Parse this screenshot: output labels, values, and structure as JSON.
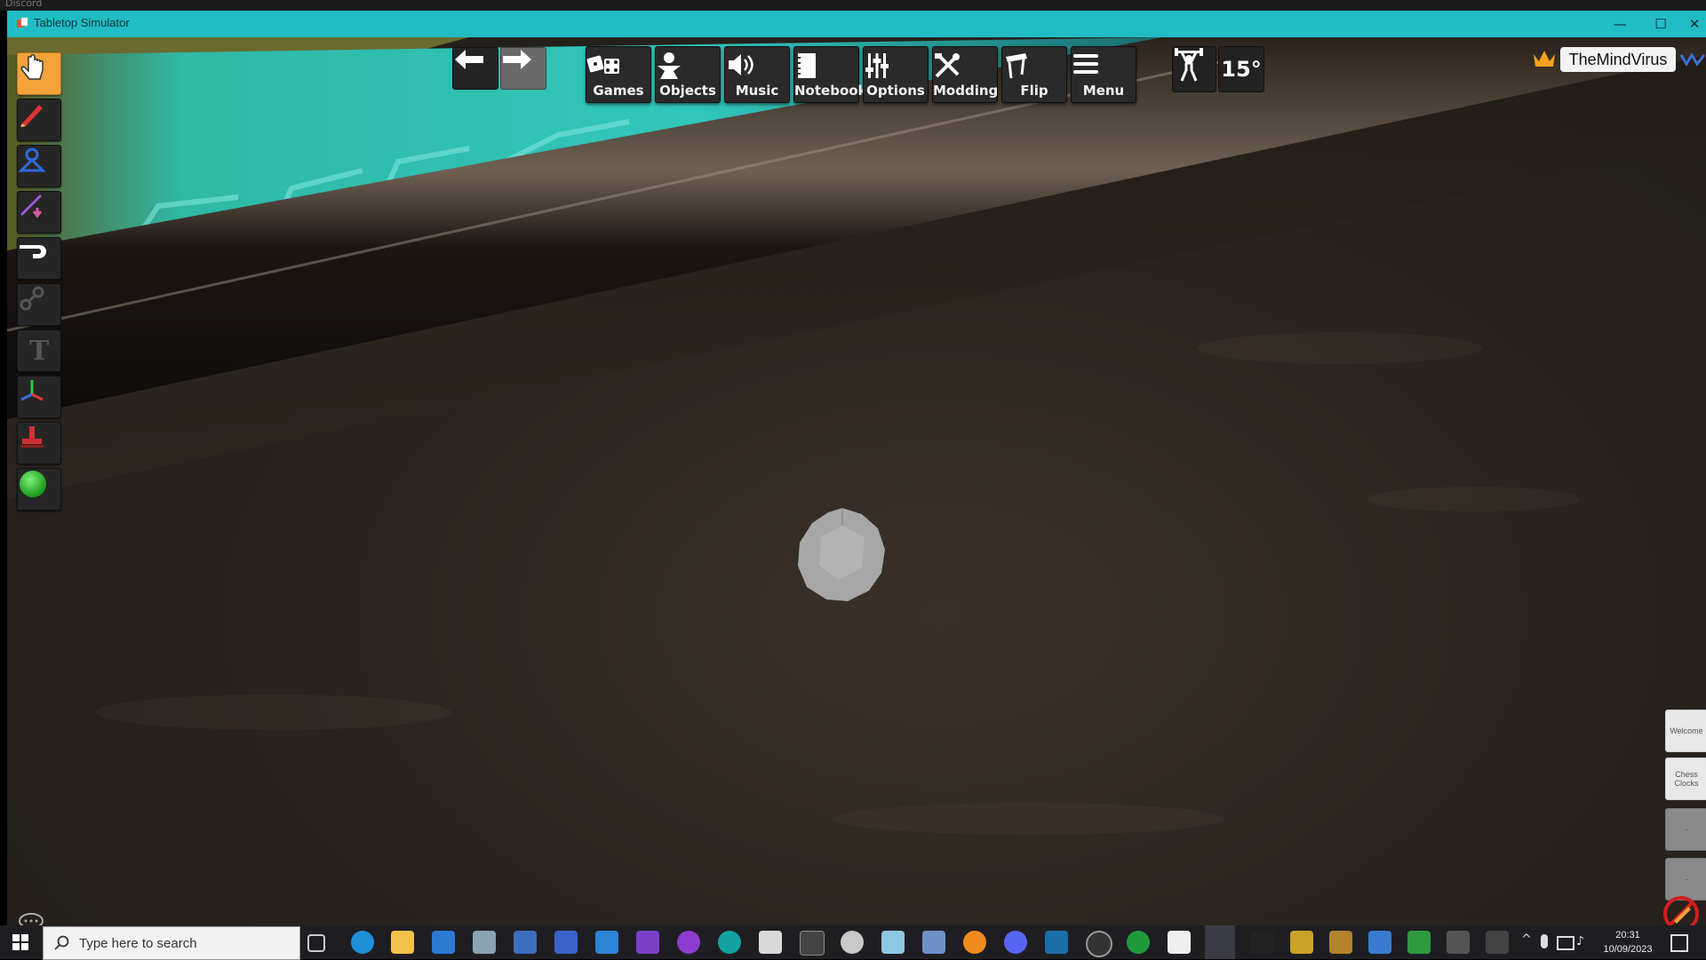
{
  "background_window": {
    "title": "Discord"
  },
  "window": {
    "title": "Tabletop Simulator",
    "controls": {
      "minimize": "—",
      "maximize": "☐",
      "close": "✕"
    }
  },
  "left_tools": [
    {
      "name": "grab",
      "icon": "hand-pointer-icon",
      "active": true
    },
    {
      "name": "draw",
      "icon": "pen-icon"
    },
    {
      "name": "zones",
      "icon": "zone-icon"
    },
    {
      "name": "line",
      "icon": "line-tool-icon"
    },
    {
      "name": "flick",
      "icon": "flick-icon"
    },
    {
      "name": "joint",
      "icon": "joint-icon"
    },
    {
      "name": "text",
      "icon": "text-tool-icon",
      "label": "T"
    },
    {
      "name": "gizmo",
      "icon": "gizmo-icon"
    },
    {
      "name": "snap",
      "icon": "snap-point-icon"
    },
    {
      "name": "decal",
      "icon": "color-ball-icon"
    }
  ],
  "top_menu": {
    "undo": "undo-arrow-icon",
    "redo": "redo-arrow-icon",
    "buttons": [
      {
        "label": "Games",
        "icon": "games-dice-icon"
      },
      {
        "label": "Objects",
        "icon": "objects-pawn-icon"
      },
      {
        "label": "Music",
        "icon": "music-speaker-icon"
      },
      {
        "label": "Notebook",
        "icon": "notebook-icon"
      },
      {
        "label": "Options",
        "icon": "options-sliders-icon"
      },
      {
        "label": "Modding",
        "icon": "modding-tools-icon"
      },
      {
        "label": "Flip",
        "icon": "flip-table-icon"
      },
      {
        "label": "Menu",
        "icon": "menu-hamburger-icon"
      }
    ],
    "rotation_snap": "15°"
  },
  "player": {
    "name": "TheMindVirus",
    "crown_color": "#f3a21d"
  },
  "side_buttons": [
    {
      "label": "Welcome"
    },
    {
      "label": "Chess Clocks"
    },
    {
      "label": "-"
    },
    {
      "label": "-"
    }
  ],
  "taskbar": {
    "search_placeholder": "Type here to search",
    "time": "20:31",
    "date": "10/09/2023"
  },
  "colors": {
    "title_bar": "#21bcc4",
    "active_tool": "#f4a23b"
  }
}
